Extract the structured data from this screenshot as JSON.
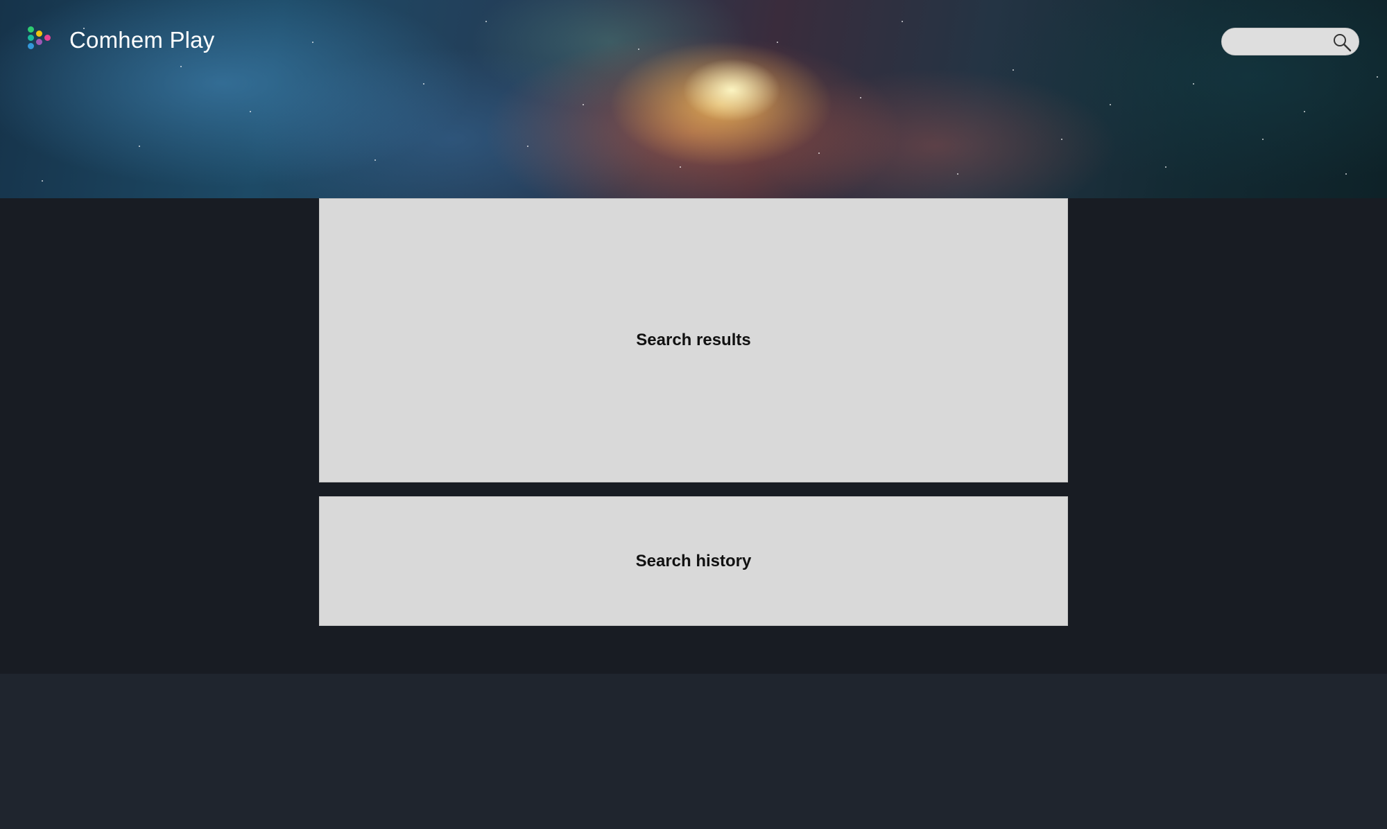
{
  "header": {
    "brand_name": "Comhem Play",
    "logo_icon": "comhem-dots-logo",
    "logo_colors": [
      "#2ecc71",
      "#f1c40f",
      "#1e90ff",
      "#e84393",
      "#9b59b6",
      "#3498db"
    ]
  },
  "search": {
    "value": "",
    "placeholder": "",
    "icon": "search-icon"
  },
  "panels": {
    "results_label": "Search results",
    "history_label": "Search history"
  },
  "colors": {
    "main_background": "#181c23",
    "footer_background": "#1f252e",
    "panel_background": "#d9d9d9"
  }
}
